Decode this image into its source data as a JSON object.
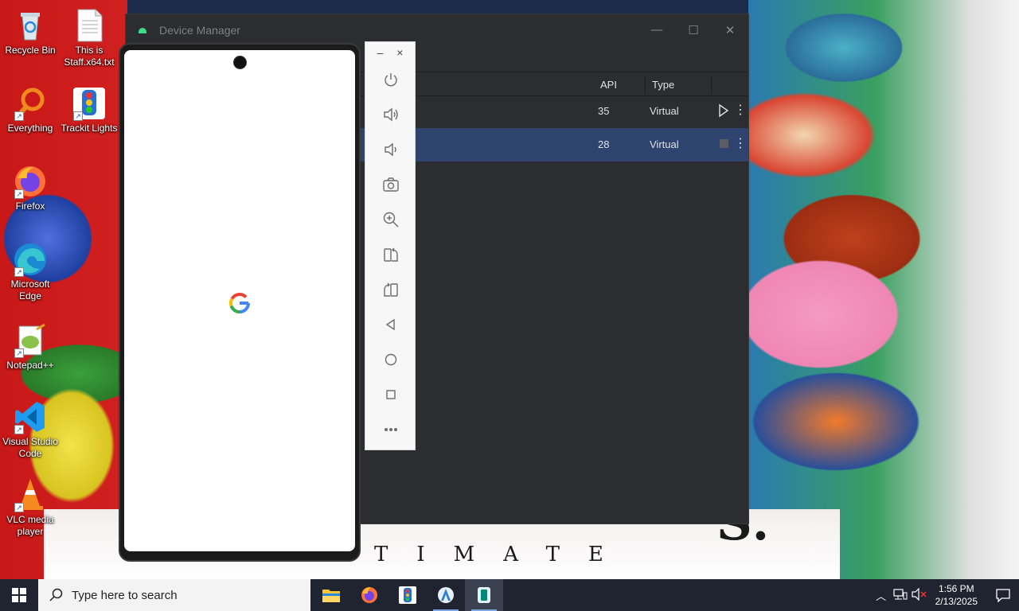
{
  "desktop": {
    "icons": [
      {
        "label": "Recycle Bin"
      },
      {
        "label": "This is Staff.x64.txt"
      },
      {
        "label": "Everything"
      },
      {
        "label": "Trackit Lights"
      },
      {
        "label": "Firefox"
      },
      {
        "label": "Microsoft Edge"
      },
      {
        "label": "Notepad++"
      },
      {
        "label": "Visual Studio Code"
      },
      {
        "label": "VLC media player"
      }
    ]
  },
  "device_manager": {
    "title": "Device Manager",
    "columns": {
      "api": "API",
      "type": "Type"
    },
    "rows": [
      {
        "api": "35",
        "type": "Virtual",
        "state": "stopped"
      },
      {
        "api": "28",
        "type": "Virtual",
        "state": "running"
      }
    ]
  },
  "emulator": {
    "toolbar": {
      "minimize": "–",
      "close": "×",
      "buttons": [
        "power",
        "volume-up",
        "volume-down",
        "screenshot",
        "zoom",
        "rotate-left",
        "rotate-right",
        "back",
        "home",
        "overview",
        "more"
      ]
    }
  },
  "taskbar": {
    "search_placeholder": "Type here to search",
    "apps": [
      "file-explorer",
      "firefox",
      "trackit-lights",
      "android-studio",
      "emulator"
    ],
    "time": "1:56 PM",
    "date": "2/13/2025"
  }
}
